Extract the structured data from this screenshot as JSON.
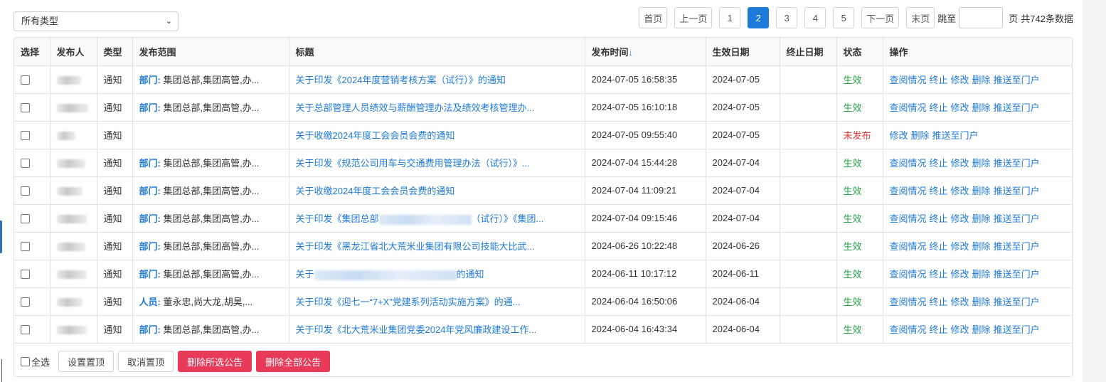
{
  "toolbar": {
    "type_filter": "所有类型",
    "pager": {
      "first": "首页",
      "prev": "上一页",
      "pages": [
        "1",
        "2",
        "3",
        "4",
        "5"
      ],
      "current": "2",
      "next": "下一页",
      "last": "末页",
      "jump_label": "跳至",
      "page_unit": "页",
      "total_text": "共742条数据"
    }
  },
  "table": {
    "headers": {
      "select": "选择",
      "publisher": "发布人",
      "type": "类型",
      "scope": "发布范围",
      "title": "标题",
      "publish_time": "发布时间",
      "sort_indicator": "↓",
      "effective_date": "生效日期",
      "end_date": "终止日期",
      "status": "状态",
      "actions": "操作"
    },
    "rows": [
      {
        "type": "通知",
        "scope_key": "部门:",
        "scope_val": "集团总部,集团高管,办...",
        "title": "关于印发《2024年度营销考核方案（试行）》的通知",
        "time": "2024-07-05 16:58:35",
        "effective": "2024-07-05",
        "end": "",
        "status": "生效",
        "actions": [
          "查阅情况",
          "终止",
          "修改",
          "删除",
          "推送至门户"
        ]
      },
      {
        "type": "通知",
        "scope_key": "部门:",
        "scope_val": "集团总部,集团高管,办...",
        "title": "关于总部管理人员绩效与薪酬管理办法及绩效考核管理办...",
        "time": "2024-07-05 16:10:18",
        "effective": "2024-07-05",
        "end": "",
        "status": "生效",
        "actions": [
          "查阅情况",
          "终止",
          "修改",
          "删除",
          "推送至门户"
        ]
      },
      {
        "type": "通知",
        "scope_key": "",
        "scope_val": "",
        "title": "关于收缴2024年度工会会员会费的通知",
        "time": "2024-07-05 09:55:40",
        "effective": "2024-07-05",
        "end": "",
        "status": "未发布",
        "actions": [
          "修改",
          "删除",
          "推送至门户"
        ]
      },
      {
        "type": "通知",
        "scope_key": "部门:",
        "scope_val": "集团总部,集团高管,办...",
        "title": "关于印发《规范公司用车与交通费用管理办法（试行）》...",
        "time": "2024-07-04 15:44:28",
        "effective": "2024-07-04",
        "end": "",
        "status": "生效",
        "actions": [
          "查阅情况",
          "终止",
          "修改",
          "删除",
          "推送至门户"
        ]
      },
      {
        "type": "通知",
        "scope_key": "部门:",
        "scope_val": "集团总部,集团高管,办...",
        "title": "关于收缴2024年度工会会员会费的通知",
        "time": "2024-07-04 11:09:21",
        "effective": "2024-07-04",
        "end": "",
        "status": "生效",
        "actions": [
          "查阅情况",
          "终止",
          "修改",
          "删除",
          "推送至门户"
        ]
      },
      {
        "type": "通知",
        "scope_key": "部门:",
        "scope_val": "集团总部,集团高管,办...",
        "title": "关于印发《集团总部",
        "title_tail": "（试行）》《集团...",
        "time": "2024-07-04 09:15:46",
        "effective": "2024-07-04",
        "end": "",
        "status": "生效",
        "actions": [
          "查阅情况",
          "终止",
          "修改",
          "删除",
          "推送至门户"
        ]
      },
      {
        "type": "通知",
        "scope_key": "部门:",
        "scope_val": "集团总部,集团高管,办...",
        "title": "关于印发《黑龙江省北大荒米业集团有限公司技能大比武...",
        "time": "2024-06-26 10:22:48",
        "effective": "2024-06-26",
        "end": "",
        "status": "生效",
        "actions": [
          "查阅情况",
          "终止",
          "修改",
          "删除",
          "推送至门户"
        ]
      },
      {
        "type": "通知",
        "scope_key": "部门:",
        "scope_val": "集团总部,集团高管,办...",
        "title": "关于",
        "title_tail": "的通知",
        "time": "2024-06-11 10:17:12",
        "effective": "2024-06-11",
        "end": "",
        "status": "生效",
        "actions": [
          "查阅情况",
          "终止",
          "修改",
          "删除",
          "推送至门户"
        ]
      },
      {
        "type": "通知",
        "scope_key": "人员:",
        "scope_val": "董永忠,尚大龙,胡昊,...",
        "title": "关于印发《迎七一“7+X”党建系列活动实施方案》的通...",
        "time": "2024-06-04 16:50:06",
        "effective": "2024-06-04",
        "end": "",
        "status": "生效",
        "actions": [
          "查阅情况",
          "终止",
          "修改",
          "删除",
          "推送至门户"
        ]
      },
      {
        "type": "通知",
        "scope_key": "部门:",
        "scope_val": "集团总部,集团高管,办...",
        "title": "关于印发《北大荒米业集团党委2024年党风廉政建设工作...",
        "time": "2024-06-04 16:43:34",
        "effective": "2024-06-04",
        "end": "",
        "status": "生效",
        "actions": [
          "查阅情况",
          "终止",
          "修改",
          "删除",
          "推送至门户"
        ]
      }
    ]
  },
  "footer": {
    "select_all": "全选",
    "pin": "设置置顶",
    "unpin": "取消置顶",
    "delete_selected": "删除所选公告",
    "delete_all": "删除全部公告"
  },
  "colors": {
    "accent": "#1e7ad9",
    "status_ok": "#22a046",
    "status_unpublished": "#e53935",
    "danger_button": "#ea3a5a"
  }
}
